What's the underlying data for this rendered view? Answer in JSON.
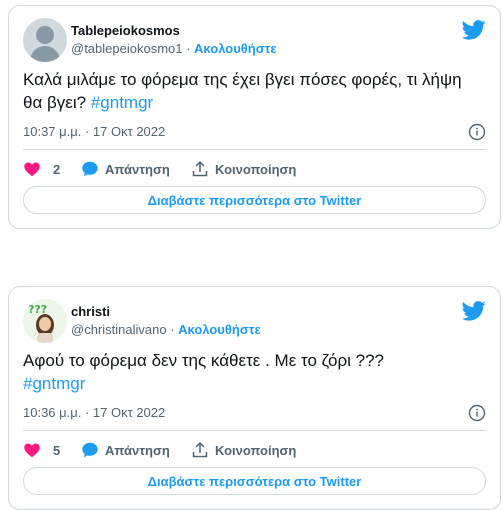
{
  "tweets": [
    {
      "name": "Tablepeiokosmos",
      "handle": "@tablepeiokosmo1",
      "separator": " · ",
      "follow_label": "Ακολουθήστε",
      "text": "Καλά μιλάμε το φόρεμα της έχει βγει πόσες φορές, τι λήψη θα βγει? ",
      "hashtag": "#gntmgr",
      "timestamp": "10:37 μ.μ. · 17 Οκτ 2022",
      "like_count": "2",
      "reply_label": "Απάντηση",
      "share_label": "Κοινοποίηση",
      "read_more_label": "Διαβάστε περισσότερα στο Twitter",
      "avatar": "default-avatar-icon"
    },
    {
      "name": "christi",
      "handle": "@christinalivano",
      "separator": " · ",
      "follow_label": "Ακολουθήστε",
      "text": "Αφού το φόρεμα δεν της κάθετε . Με το ζόρι ??? ",
      "hashtag": "#gntmgr",
      "timestamp": "10:36 μ.μ. · 17 Οκτ 2022",
      "like_count": "5",
      "reply_label": "Απάντηση",
      "share_label": "Κοινοποίηση",
      "read_more_label": "Διαβάστε περισσότερα στο Twitter",
      "avatar": "profile-photo"
    }
  ],
  "colors": {
    "accent": "#1d9bf0",
    "like": "#f91880",
    "text": "#0f1419",
    "muted": "#536471",
    "border": "#cfd9de"
  }
}
